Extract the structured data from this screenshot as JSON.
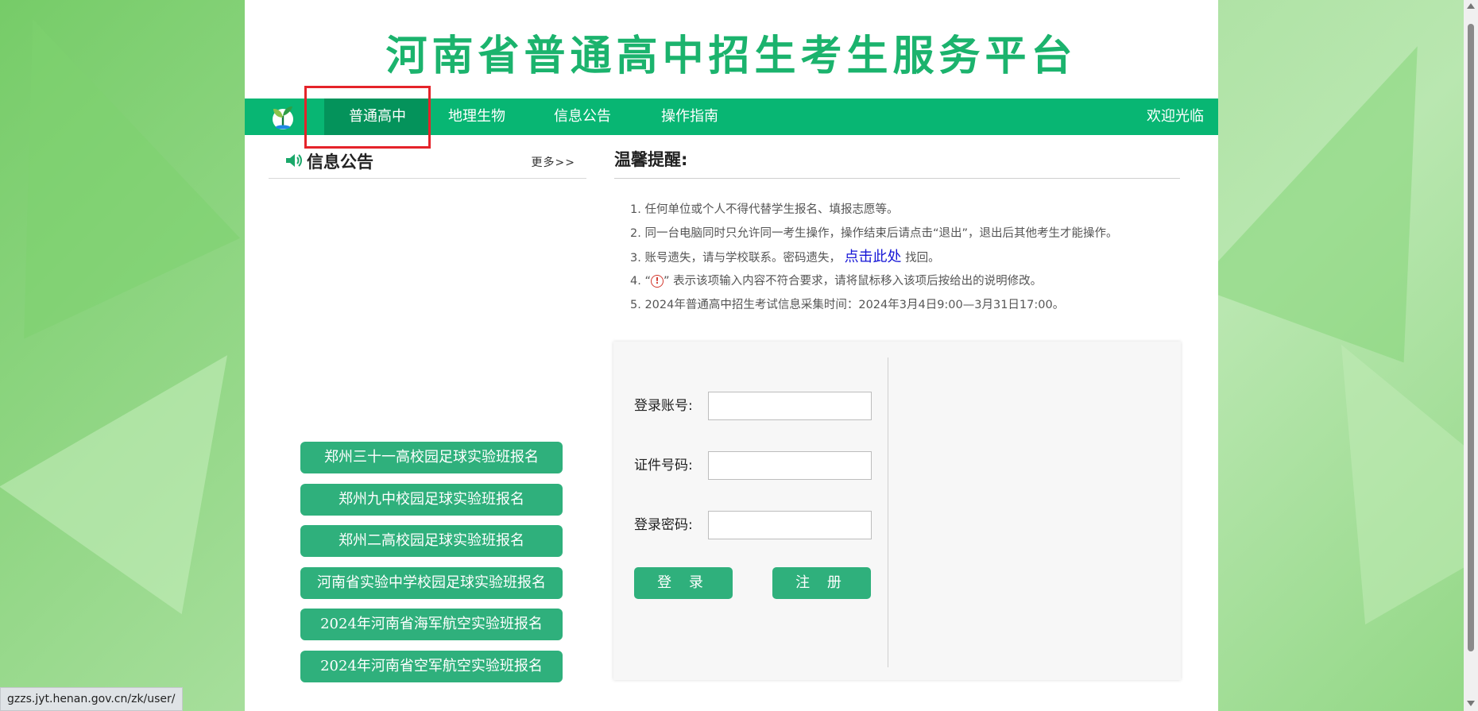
{
  "header": {
    "title": "河南省普通高中招生考生服务平台"
  },
  "nav": {
    "items": [
      {
        "label": "普通高中",
        "active": true
      },
      {
        "label": "地理生物"
      },
      {
        "label": "信息公告"
      },
      {
        "label": "操作指南"
      }
    ],
    "welcome": "欢迎光临",
    "logo_icon": "sprout-logo-icon"
  },
  "notice": {
    "title": "信息公告",
    "more": "更多>>",
    "icon": "speaker-icon"
  },
  "quick_links": [
    "郑州三十一高校园足球实验班报名",
    "郑州九中校园足球实验班报名",
    "郑州二高校园足球实验班报名",
    "河南省实验中学校园足球实验班报名",
    "2024年河南省海军航空实验班报名",
    "2024年河南省空军航空实验班报名"
  ],
  "tips": {
    "title": "温馨提醒:",
    "items": {
      "t1": "1. 任何单位或个人不得代替学生报名、填报志愿等。",
      "t2": "2. 同一台电脑同时只允许同一考生操作，操作结束后请点击“退出”，退出后其他考生才能操作。",
      "t3_pre": "3. 账号遗失，请与学校联系。密码遗失，",
      "t3_link": "点击此处",
      "t3_post": " 找回。",
      "t4_pre": "4. “",
      "t4_icon_text": "!",
      "t4_post": "” 表示该项输入内容不符合要求，请将鼠标移入该项后按给出的说明修改。",
      "t5": "5. 2024年普通高中招生考试信息采集时间：2024年3月4日9:00—3月31日17:00。"
    }
  },
  "login": {
    "account_label": "登录账号:",
    "id_label": "证件号码:",
    "password_label": "登录密码:",
    "account_value": "",
    "id_value": "",
    "password_value": "",
    "login_button": "登 录",
    "register_button": "注 册"
  },
  "status_bar": {
    "url": "gzzs.jyt.henan.gov.cn/zk/user/"
  },
  "colors": {
    "brand_green": "#08b673",
    "title_green": "#1bb36d",
    "button_green": "#2fb07c",
    "highlight_red": "#e5232a"
  }
}
